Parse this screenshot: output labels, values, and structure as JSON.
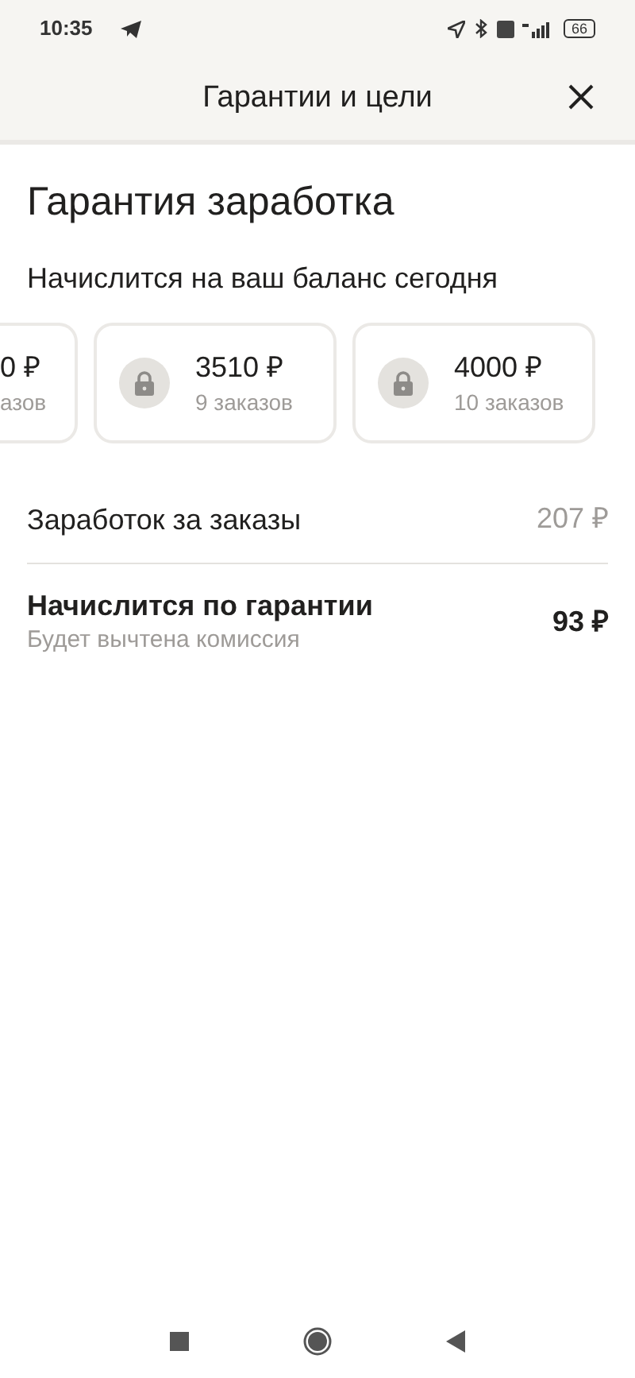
{
  "status_bar": {
    "time": "10:35",
    "battery": "66"
  },
  "header": {
    "title": "Гарантии и цели"
  },
  "section": {
    "title": "Гарантия заработка",
    "subtitle": "Начислится на ваш баланс сегодня"
  },
  "goals": [
    {
      "kind": "partial",
      "amount": "0 ₽",
      "orders": "азов"
    },
    {
      "kind": "locked",
      "amount": "3510 ₽",
      "orders": "9 заказов"
    },
    {
      "kind": "locked",
      "amount": "4000 ₽",
      "orders": "10 заказов"
    }
  ],
  "rows": [
    {
      "label": "Заработок за заказы",
      "value": "207 ₽",
      "emphasis": false
    },
    {
      "label": "Начислится по гарантии",
      "note": "Будет вычтена комиссия",
      "value": "93 ₽",
      "emphasis": true
    }
  ]
}
